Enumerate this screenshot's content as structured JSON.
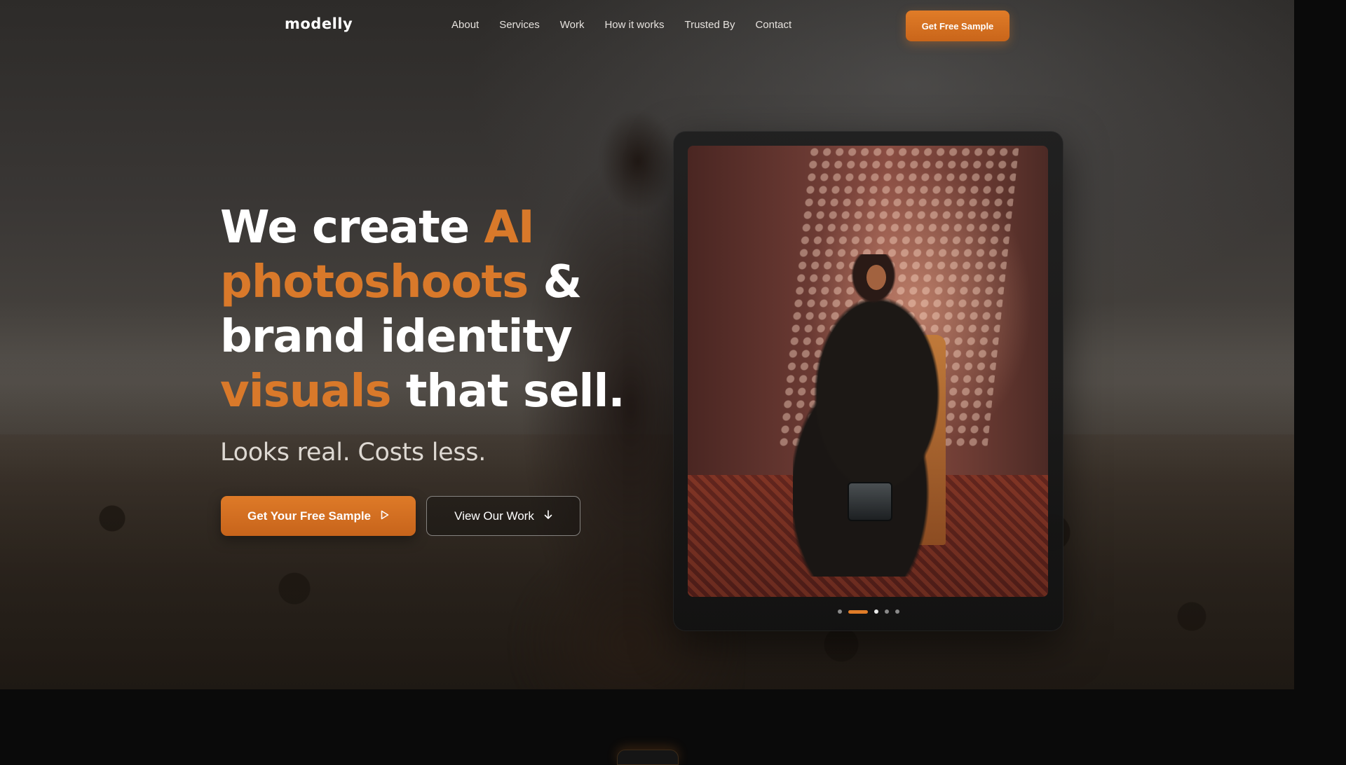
{
  "brand": {
    "logo": "modelly"
  },
  "nav": {
    "links": [
      "About",
      "Services",
      "Work",
      "How it works",
      "Trusted By",
      "Contact"
    ],
    "cta": "Get Free Sample"
  },
  "hero": {
    "headline": {
      "line1_a": "We create ",
      "line1_b": "AI",
      "line2_a": "photoshoots",
      "line2_b": " &",
      "line3": "brand identity",
      "line4_a": "visuals",
      "line4_b": " that sell."
    },
    "subhead": "Looks real. Costs less.",
    "primary_button": "Get Your Free Sample",
    "secondary_button": "View Our Work"
  },
  "carousel": {
    "slides_count": 5,
    "active_index": 1
  },
  "colors": {
    "accent": "#d9792a",
    "background": "#0a0a0a",
    "text": "#ffffff"
  },
  "icons": {
    "primary_button_icon": "play-outline-icon",
    "secondary_button_icon": "arrow-down-icon"
  }
}
